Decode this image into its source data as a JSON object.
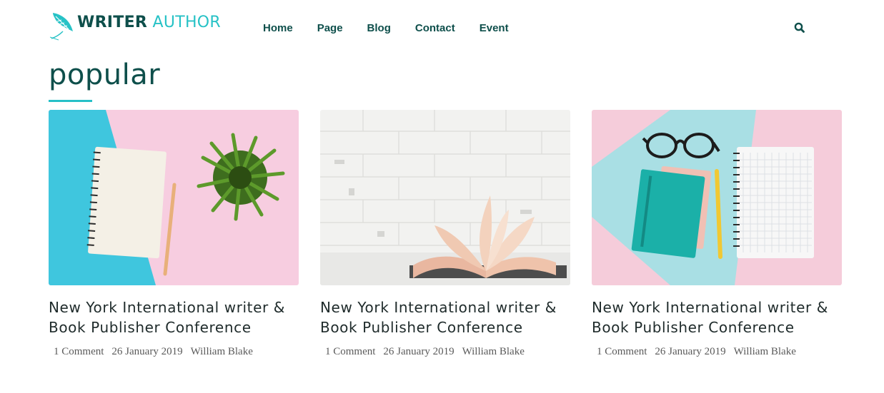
{
  "header": {
    "logo": {
      "bold": "WRITER",
      "light": "AUTHOR"
    },
    "nav": [
      "Home",
      "Page",
      "Blog",
      "Contact",
      "Event"
    ],
    "search_icon": "search-icon"
  },
  "section": {
    "title": "popular"
  },
  "cards": [
    {
      "image": "notebook-pencil-plant-photo",
      "title_line1": "New York International writer &",
      "title_line2": "Book Publisher Conference",
      "comments": "1 Comment",
      "date": "26 January 2019",
      "author": "William Blake"
    },
    {
      "image": "open-book-brick-wall-photo",
      "title_line1": "New York International writer &",
      "title_line2": "Book Publisher Conference",
      "comments": "1 Comment",
      "date": "26 January 2019",
      "author": "William Blake"
    },
    {
      "image": "glasses-notebooks-pen-photo",
      "title_line1": "New York International writer &",
      "title_line2": "Book Publisher Conference",
      "comments": "1 Comment",
      "date": "26 January 2019",
      "author": "William Blake"
    }
  ],
  "colors": {
    "brand_dark": "#0e4f4b",
    "accent": "#26c0c8",
    "text": "#1f2b2b",
    "meta": "#5a5a5a"
  }
}
